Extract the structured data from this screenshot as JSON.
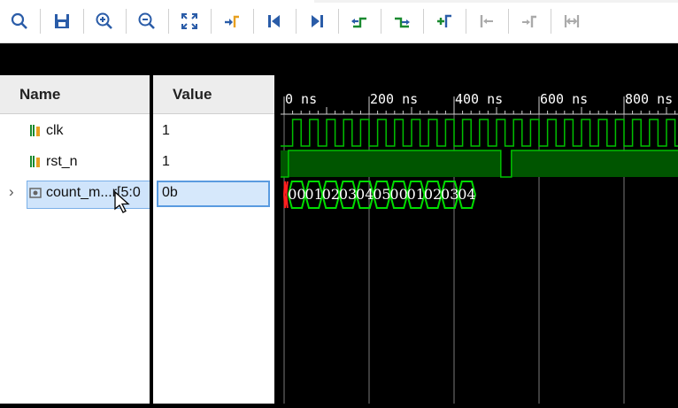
{
  "toolbar": {
    "buttons": [
      {
        "icon": "search-icon"
      },
      {
        "icon": "save-icon"
      },
      {
        "icon": "zoom-in-icon"
      },
      {
        "icon": "zoom-out-icon"
      },
      {
        "icon": "zoom-fit-icon"
      },
      {
        "icon": "go-to-cursor-icon"
      },
      {
        "icon": "go-to-time-zero-icon"
      },
      {
        "icon": "go-to-last-time-icon"
      },
      {
        "icon": "previous-transition-icon"
      },
      {
        "icon": "next-transition-icon"
      },
      {
        "icon": "add-marker-icon"
      },
      {
        "icon": "previous-marker-icon"
      },
      {
        "icon": "next-marker-icon"
      },
      {
        "icon": "swap-cursors-icon"
      }
    ]
  },
  "columns": {
    "name": "Name",
    "value": "Value"
  },
  "signals": [
    {
      "name": "clk",
      "value": "1",
      "icon": "signal-icon"
    },
    {
      "name": "rst_n",
      "value": "1",
      "icon": "signal-icon"
    },
    {
      "name": "count_m...r[5:0",
      "value": "0b",
      "icon": "bus-icon",
      "selected": true
    }
  ],
  "timeline": {
    "labels": [
      "0 ns",
      "200 ns",
      "400 ns",
      "600 ns",
      "800 ns"
    ]
  },
  "bus_values": [
    "00",
    "01",
    "02",
    "03",
    "04",
    "05",
    "00",
    "01",
    "02",
    "03",
    "04"
  ],
  "colors": {
    "wave": "#00c000",
    "wave_fill": "#005500",
    "bus": "#00dd00",
    "undefined": "#ff2020",
    "grid": "#7a7a7a"
  }
}
